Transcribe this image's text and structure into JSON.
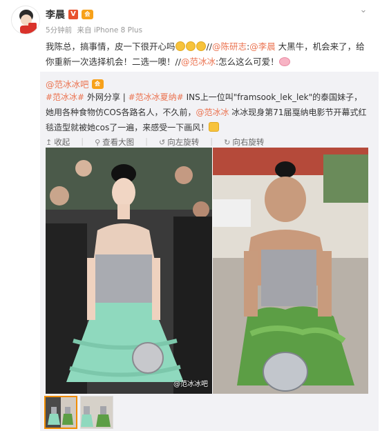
{
  "post": {
    "author": "李晨",
    "verified_icon": "v-badge-icon",
    "vip_icon": "vip-icon",
    "vip_text": "会",
    "time": "5分钟前",
    "source": "来自 iPhone 8 Plus",
    "more_icon": "chevron-down-icon",
    "text_part1": "我陈总，搞事情，皮一下很开心吗",
    "text_part2": "//",
    "mention1": "@陈研志",
    "text_part3": ":",
    "mention2": "@李晨",
    "text_part4": " 大黑牛，机会来了，给你重新一次选择机会！二选一噢！//",
    "mention3": "@范冰冰",
    "text_part5": ":怎么这么可爱！"
  },
  "repost": {
    "author": "@范冰冰吧",
    "vip_text": "会",
    "tag1": "#范冰冰#",
    "text1": " 外网分享 | ",
    "tag2": "#范冰冰夏纳#",
    "text2": " INS上一位叫\"framsook_lek_lek\"的泰国妹子，她用各种食物仿COS各路名人，不久前，",
    "mention": "@范冰冰",
    "text3": " 冰冰现身第71届戛纳电影节开幕式红毯造型就被她cos了一遍，来感受一下画风！",
    "toolbar": {
      "collect": "收起",
      "view_large": "查看大图",
      "rotate_left": "向左旋转",
      "rotate_right": "向右旋转"
    },
    "watermark": "@范冰冰吧"
  },
  "colors": {
    "accent": "#eb7350",
    "repost_bg": "#f2f2f5",
    "dress_green": "#8fd9be",
    "selected_thumb": "#f08c00"
  }
}
